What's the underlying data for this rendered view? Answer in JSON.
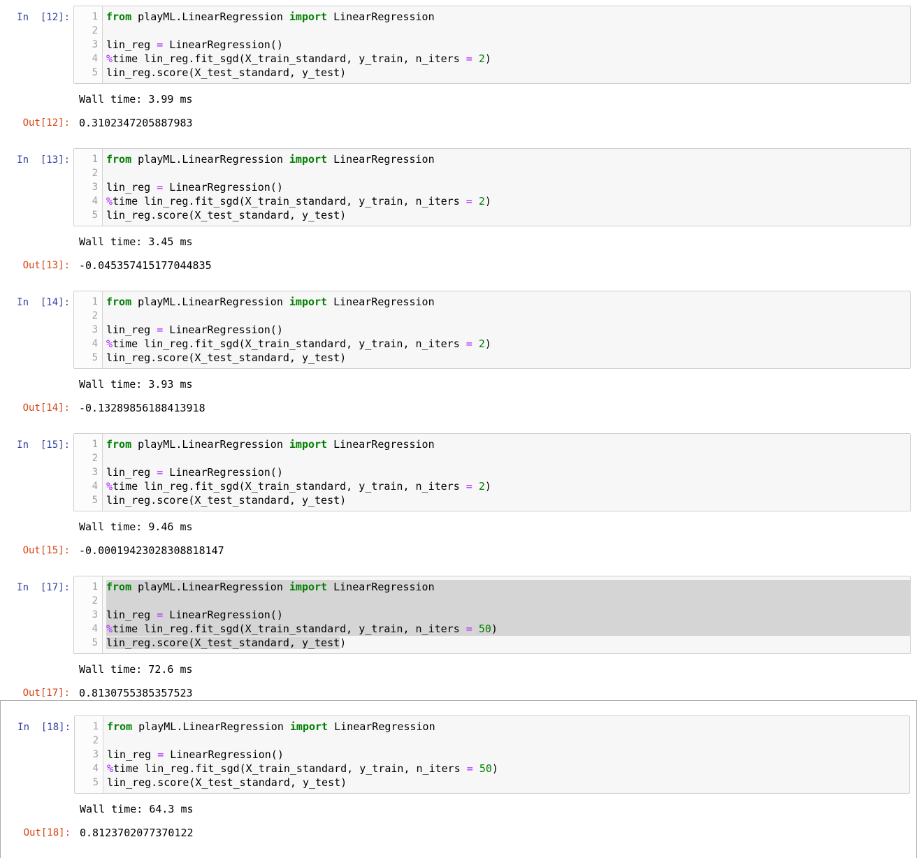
{
  "colors": {
    "in_prompt": "#303F9F",
    "out_prompt": "#D84315",
    "keyword_green": "#008000",
    "operator_violet": "#AA22FF",
    "number_green": "#008000",
    "selection_gray": "#d5d5d5",
    "cell_background": "#f7f7f7",
    "cell_border": "#cfcfcf",
    "selected_cell_border": "#ababab"
  },
  "notebook": {
    "line_numbers": [
      "1",
      "2",
      "3",
      "4",
      "5"
    ],
    "cells": [
      {
        "in_label": "In  [12]:",
        "out_label": "Out[12]:",
        "wall_time": "Wall time: 3.99 ms",
        "out_value": "0.3102347205887983",
        "is_selected_cell": false,
        "code": [
          {
            "tokens": [
              {
                "t": "from",
                "c": "kw"
              },
              {
                "t": " playML.LinearRegression ",
                "c": "pl"
              },
              {
                "t": "import",
                "c": "kw"
              },
              {
                "t": " LinearRegression",
                "c": "pl"
              }
            ]
          },
          {
            "tokens": []
          },
          {
            "tokens": [
              {
                "t": "lin_reg ",
                "c": "pl"
              },
              {
                "t": "=",
                "c": "op"
              },
              {
                "t": " LinearRegression()",
                "c": "pl"
              }
            ]
          },
          {
            "tokens": [
              {
                "t": "%",
                "c": "op"
              },
              {
                "t": "time lin_reg.fit_sgd(X_train_standard, y_train, n_iters ",
                "c": "pl"
              },
              {
                "t": "=",
                "c": "op"
              },
              {
                "t": " ",
                "c": "pl"
              },
              {
                "t": "2",
                "c": "num"
              },
              {
                "t": ")",
                "c": "pl"
              }
            ]
          },
          {
            "tokens": [
              {
                "t": "lin_reg.score(X_test_standard, y_test)",
                "c": "pl"
              }
            ]
          }
        ]
      },
      {
        "in_label": "In  [13]:",
        "out_label": "Out[13]:",
        "wall_time": "Wall time: 3.45 ms",
        "out_value": "-0.045357415177044835",
        "is_selected_cell": false,
        "code": [
          {
            "tokens": [
              {
                "t": "from",
                "c": "kw"
              },
              {
                "t": " playML.LinearRegression ",
                "c": "pl"
              },
              {
                "t": "import",
                "c": "kw"
              },
              {
                "t": " LinearRegression",
                "c": "pl"
              }
            ]
          },
          {
            "tokens": []
          },
          {
            "tokens": [
              {
                "t": "lin_reg ",
                "c": "pl"
              },
              {
                "t": "=",
                "c": "op"
              },
              {
                "t": " LinearRegression()",
                "c": "pl"
              }
            ]
          },
          {
            "tokens": [
              {
                "t": "%",
                "c": "op"
              },
              {
                "t": "time lin_reg.fit_sgd(X_train_standard, y_train, n_iters ",
                "c": "pl"
              },
              {
                "t": "=",
                "c": "op"
              },
              {
                "t": " ",
                "c": "pl"
              },
              {
                "t": "2",
                "c": "num"
              },
              {
                "t": ")",
                "c": "pl"
              }
            ]
          },
          {
            "tokens": [
              {
                "t": "lin_reg.score(X_test_standard, y_test)",
                "c": "pl"
              }
            ]
          }
        ]
      },
      {
        "in_label": "In  [14]:",
        "out_label": "Out[14]:",
        "wall_time": "Wall time: 3.93 ms",
        "out_value": "-0.13289856188413918",
        "is_selected_cell": false,
        "code": [
          {
            "tokens": [
              {
                "t": "from",
                "c": "kw"
              },
              {
                "t": " playML.LinearRegression ",
                "c": "pl"
              },
              {
                "t": "import",
                "c": "kw"
              },
              {
                "t": " LinearRegression",
                "c": "pl"
              }
            ]
          },
          {
            "tokens": []
          },
          {
            "tokens": [
              {
                "t": "lin_reg ",
                "c": "pl"
              },
              {
                "t": "=",
                "c": "op"
              },
              {
                "t": " LinearRegression()",
                "c": "pl"
              }
            ]
          },
          {
            "tokens": [
              {
                "t": "%",
                "c": "op"
              },
              {
                "t": "time lin_reg.fit_sgd(X_train_standard, y_train, n_iters ",
                "c": "pl"
              },
              {
                "t": "=",
                "c": "op"
              },
              {
                "t": " ",
                "c": "pl"
              },
              {
                "t": "2",
                "c": "num"
              },
              {
                "t": ")",
                "c": "pl"
              }
            ]
          },
          {
            "tokens": [
              {
                "t": "lin_reg.score(X_test_standard, y_test)",
                "c": "pl"
              }
            ]
          }
        ]
      },
      {
        "in_label": "In  [15]:",
        "out_label": "Out[15]:",
        "wall_time": "Wall time: 9.46 ms",
        "out_value": "-0.00019423028308818147",
        "is_selected_cell": false,
        "code": [
          {
            "tokens": [
              {
                "t": "from",
                "c": "kw"
              },
              {
                "t": " playML.LinearRegression ",
                "c": "pl"
              },
              {
                "t": "import",
                "c": "kw"
              },
              {
                "t": " LinearRegression",
                "c": "pl"
              }
            ]
          },
          {
            "tokens": []
          },
          {
            "tokens": [
              {
                "t": "lin_reg ",
                "c": "pl"
              },
              {
                "t": "=",
                "c": "op"
              },
              {
                "t": " LinearRegression()",
                "c": "pl"
              }
            ]
          },
          {
            "tokens": [
              {
                "t": "%",
                "c": "op"
              },
              {
                "t": "time lin_reg.fit_sgd(X_train_standard, y_train, n_iters ",
                "c": "pl"
              },
              {
                "t": "=",
                "c": "op"
              },
              {
                "t": " ",
                "c": "pl"
              },
              {
                "t": "2",
                "c": "num"
              },
              {
                "t": ")",
                "c": "pl"
              }
            ]
          },
          {
            "tokens": [
              {
                "t": "lin_reg.score(X_test_standard, y_test)",
                "c": "pl"
              }
            ]
          }
        ]
      },
      {
        "in_label": "In  [17]:",
        "out_label": "Out[17]:",
        "wall_time": "Wall time: 72.6 ms",
        "out_value": "0.8130755385357523",
        "is_selected_cell": false,
        "code": [
          {
            "sel": "full",
            "tokens": [
              {
                "t": "from",
                "c": "kw",
                "s": true
              },
              {
                "t": " playML.LinearRegression ",
                "c": "pl",
                "s": true
              },
              {
                "t": "import",
                "c": "kw",
                "s": true
              },
              {
                "t": " LinearRegression",
                "c": "pl",
                "s": true
              }
            ]
          },
          {
            "sel": "full",
            "tokens": []
          },
          {
            "sel": "full",
            "tokens": [
              {
                "t": "lin_reg ",
                "c": "pl",
                "s": true
              },
              {
                "t": "=",
                "c": "op",
                "s": true
              },
              {
                "t": " LinearRegression()",
                "c": "pl",
                "s": true
              }
            ]
          },
          {
            "sel": "full",
            "tokens": [
              {
                "t": "%",
                "c": "op",
                "s": true
              },
              {
                "t": "time lin_reg.fit_sgd(X_train_standard, y_train, n_iters ",
                "c": "pl",
                "s": true
              },
              {
                "t": "=",
                "c": "op",
                "s": true
              },
              {
                "t": " ",
                "c": "pl",
                "s": true
              },
              {
                "t": "50",
                "c": "num",
                "s": true
              },
              {
                "t": ")",
                "c": "pl",
                "s": true
              }
            ]
          },
          {
            "tokens": [
              {
                "t": "lin_reg.score(X_test_standard, y_test",
                "c": "pl",
                "s": true
              },
              {
                "t": ")",
                "c": "pl"
              }
            ]
          }
        ]
      },
      {
        "in_label": "In  [18]:",
        "out_label": "Out[18]:",
        "wall_time": "Wall time: 64.3 ms",
        "out_value": "0.8123702077370122",
        "is_selected_cell": true,
        "code": [
          {
            "tokens": [
              {
                "t": "from",
                "c": "kw"
              },
              {
                "t": " playML.LinearRegression ",
                "c": "pl"
              },
              {
                "t": "import",
                "c": "kw"
              },
              {
                "t": " LinearRegression",
                "c": "pl"
              }
            ]
          },
          {
            "tokens": []
          },
          {
            "tokens": [
              {
                "t": "lin_reg ",
                "c": "pl"
              },
              {
                "t": "=",
                "c": "op"
              },
              {
                "t": " LinearRegression()",
                "c": "pl"
              }
            ]
          },
          {
            "tokens": [
              {
                "t": "%",
                "c": "op"
              },
              {
                "t": "time lin_reg.fit_sgd(X_train_standard, y_train, n_iters ",
                "c": "pl"
              },
              {
                "t": "=",
                "c": "op"
              },
              {
                "t": " ",
                "c": "pl"
              },
              {
                "t": "50",
                "c": "num"
              },
              {
                "t": ")",
                "c": "pl"
              }
            ]
          },
          {
            "tokens": [
              {
                "t": "lin_reg.score(X_test_standard, y_test)",
                "c": "pl"
              }
            ]
          }
        ]
      }
    ]
  }
}
